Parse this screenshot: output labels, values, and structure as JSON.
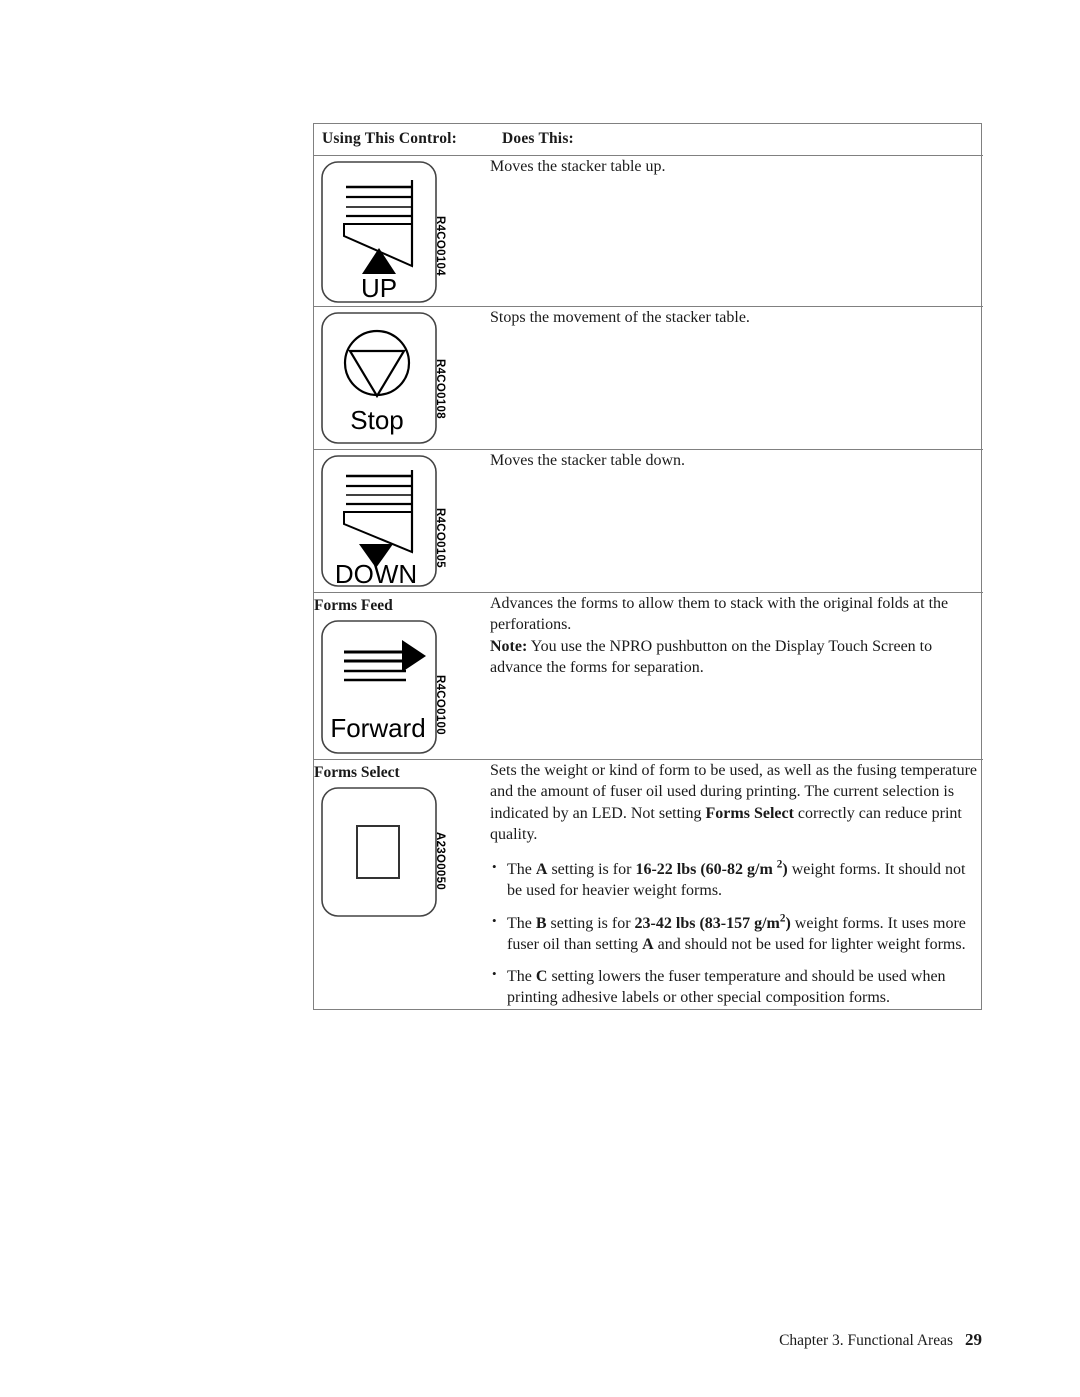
{
  "table": {
    "headers": {
      "col1": "Using This Control:",
      "col2": "Does This:"
    },
    "rows": [
      {
        "control_label": "",
        "button_text": "UP",
        "icon_name": "stacker-table-up-icon",
        "ref_code": "R4CO0104",
        "description_paragraphs": [
          "Moves the stacker table up."
        ]
      },
      {
        "control_label": "",
        "button_text": "Stop",
        "icon_name": "stop-triangle-in-circle-icon",
        "ref_code": "R4CO0108",
        "description_paragraphs": [
          "Stops the movement of the stacker table."
        ]
      },
      {
        "control_label": "",
        "button_text": "DOWN",
        "icon_name": "stacker-table-down-icon",
        "ref_code": "R4CO0105",
        "description_paragraphs": [
          "Moves the stacker table down."
        ]
      },
      {
        "control_label": "Forms Feed",
        "button_text": "Forward",
        "icon_name": "forms-forward-arrow-icon",
        "ref_code": "R4CO0100",
        "description_paragraphs": [
          "Advances the forms to allow them to stack with the original folds at the perforations.",
          "Note: You use the NPRO pushbutton on the Display Touch Screen to advance the forms for separation."
        ],
        "note_prefix": "Note:",
        "note_body": " You use the NPRO pushbutton on the Display Touch Screen to advance the forms for separation."
      },
      {
        "control_label": "Forms Select",
        "button_text": "",
        "icon_name": "forms-select-square-icon",
        "ref_code": "A23O0050",
        "description_paragraphs": [
          "Sets the weight or kind of form to be used, as well as the fusing temperature and the amount of fuser oil used during printing. The current selection is indicated by an LED. Not setting Forms Select correctly can reduce print quality."
        ],
        "intro_part1": "Sets the weight or kind of form to be used, as well as the fusing temperature and the amount of fuser oil used during printing. The current selection is indicated by an LED. Not setting ",
        "intro_bold": "Forms Select",
        "intro_part2": " correctly can reduce print quality.",
        "bullets": [
          {
            "t1": "The ",
            "b1": "A",
            "t2": " setting is for ",
            "b2": "16-22 lbs (60-82 g/m ",
            "sup": "2",
            "b3": ")",
            "t3": " weight forms. It should not be used for heavier weight forms."
          },
          {
            "t1": "The ",
            "b1": "B",
            "t2": " setting is for ",
            "b2": "23-42 lbs (83-157 g/m",
            "sup": "2",
            "b3": ")",
            "t3": " weight forms. It uses more fuser oil than setting ",
            "b4": "A",
            "t4": " and should not be used for lighter weight forms."
          },
          {
            "t1": "The ",
            "b1": "C",
            "t2": " setting lowers the fuser temperature and should be used when printing adhesive labels or other special composition forms."
          }
        ]
      }
    ]
  },
  "footer": {
    "chapter": "Chapter 3. Functional Areas",
    "page_number": "29"
  },
  "colors": {
    "border": "#808080",
    "text": "#1a1a1a",
    "ink": "#000000"
  }
}
